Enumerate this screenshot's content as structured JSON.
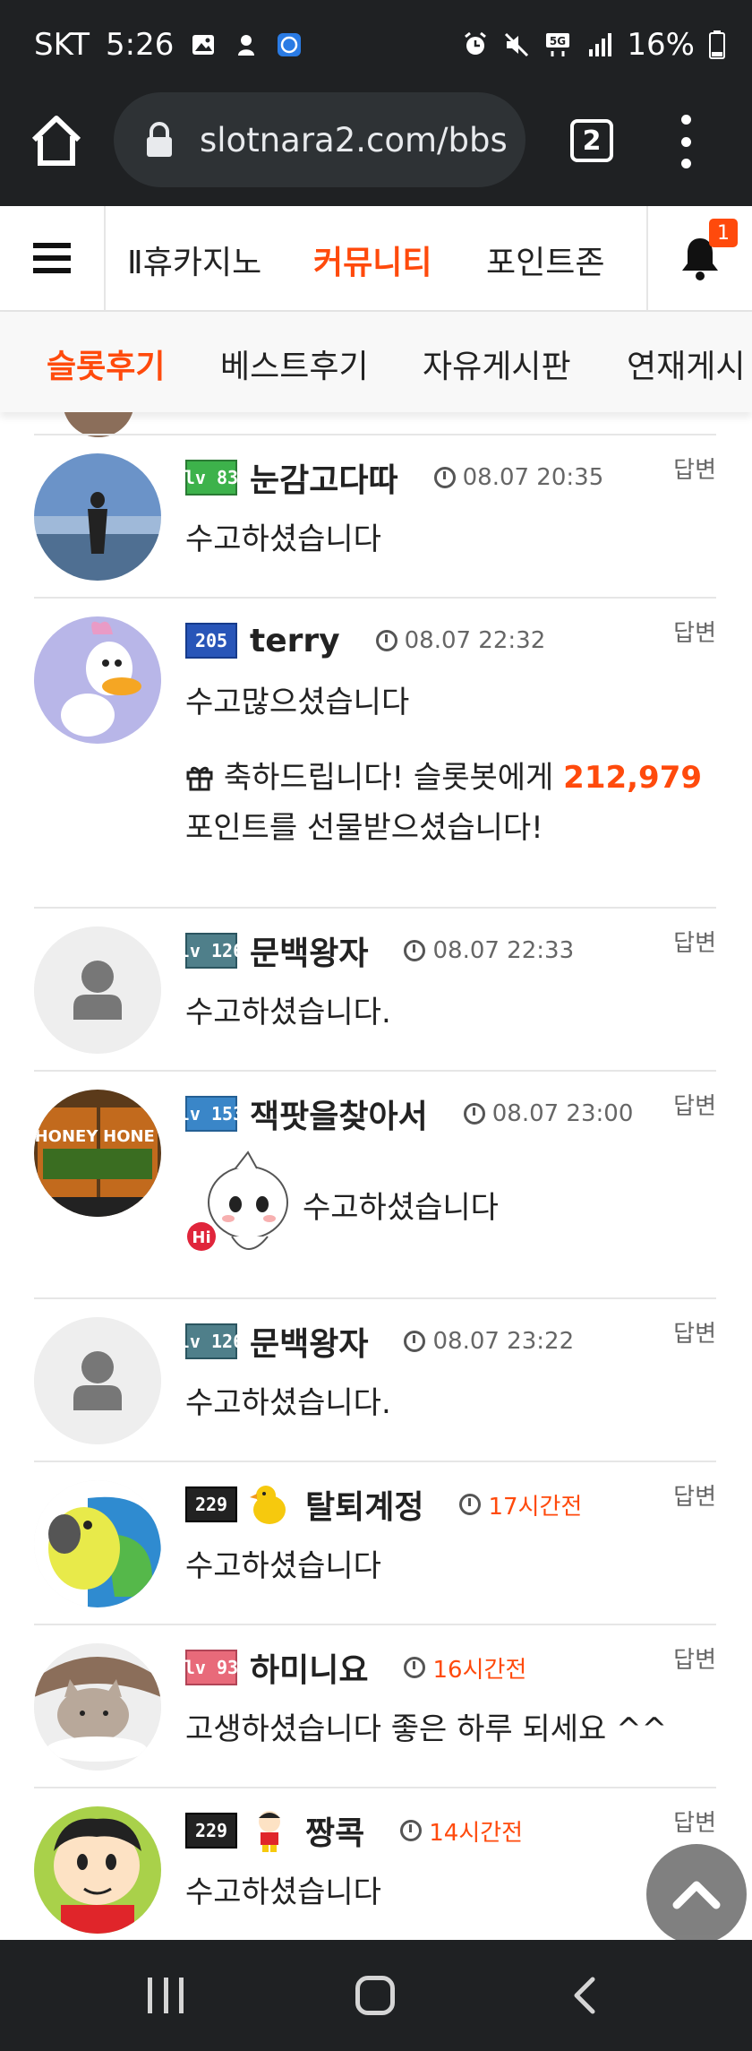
{
  "status_bar": {
    "carrier": "SKT",
    "time": "5:26",
    "battery": "16%",
    "network": "5G"
  },
  "browser": {
    "url": "slotnara2.com/bbs",
    "tab_count": "2"
  },
  "site_nav": {
    "items": [
      "Ⅱ휴카지노",
      "커뮤니티",
      "포인트존"
    ],
    "active": "커뮤니티",
    "notification_count": "1"
  },
  "sub_nav": {
    "items": [
      "슬롯후기",
      "베스트후기",
      "자유게시판",
      "연재게시"
    ],
    "active": "슬롯후기"
  },
  "comments": [
    {
      "level": "lv 83",
      "nickname": "눈감고다따",
      "time": "08.07 20:35",
      "reply": "답변",
      "text": "수고하셨습니다",
      "avatar": "person-by-sea"
    },
    {
      "level": "205",
      "nickname": "terry",
      "time": "08.07 22:32",
      "reply": "답변",
      "text": "수고많으셨습니다",
      "gift": {
        "prefix": "축하드립니다! 슬롯봇에게",
        "points": "212,979",
        "suffix": "포인트를 선물받으셨습니다!"
      },
      "avatar": "daisy-duck"
    },
    {
      "level": "lv 126",
      "nickname": "문백왕자",
      "time": "08.07 22:33",
      "reply": "답변",
      "text": "수고하셨습니다.",
      "avatar": "default-user"
    },
    {
      "level": "lv 153",
      "nickname": "잭팟을찾아서",
      "time": "08.07 23:00",
      "reply": "답변",
      "text": "수고하셨습니다",
      "emoticon": "hi-character",
      "avatar": "honey-money-slot"
    },
    {
      "level": "lv 126",
      "nickname": "문백왕자",
      "time": "08.07 23:22",
      "reply": "답변",
      "text": "수고하셨습니다.",
      "avatar": "default-user"
    },
    {
      "level": "229",
      "nickname": "탈퇴계정",
      "time": "17시간전",
      "reply": "답변",
      "text": "수고하셨습니다",
      "avatar": "parrot"
    },
    {
      "level": "lv 93",
      "nickname": "하미니요",
      "time": "16시간전",
      "reply": "답변",
      "text": "고생하셨습니다 좋은 하루 되세요 ^^",
      "avatar": "cat"
    },
    {
      "level": "229",
      "nickname": "짱콕",
      "time": "14시간전",
      "reply": "답변",
      "text": "수고하셨습니다",
      "avatar": "shinchan"
    }
  ],
  "colors": {
    "accent": "#ff4a0c",
    "chrome_dark": "#1f2123",
    "url_box": "#2e3235"
  }
}
